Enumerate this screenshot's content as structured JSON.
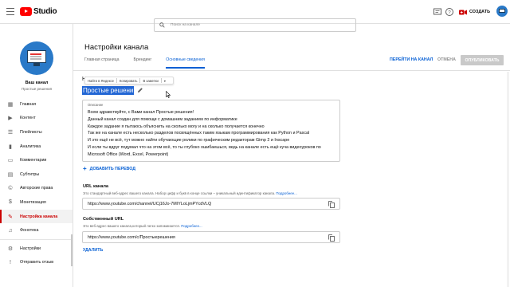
{
  "topbar": {
    "logo_text": "Studio",
    "search_placeholder": "Поиск на канале",
    "create_label": "СОЗДАТЬ"
  },
  "sidebar": {
    "channel_name": "Ваш канал",
    "channel_subtitle": "Простые решения",
    "items": [
      {
        "label": "Главная",
        "icon": "dashboard-icon"
      },
      {
        "label": "Контент",
        "icon": "content-icon"
      },
      {
        "label": "Плейлисты",
        "icon": "playlists-icon"
      },
      {
        "label": "Аналитика",
        "icon": "analytics-icon"
      },
      {
        "label": "Комментарии",
        "icon": "comments-icon"
      },
      {
        "label": "Субтитры",
        "icon": "subtitles-icon"
      },
      {
        "label": "Авторские права",
        "icon": "copyright-icon"
      },
      {
        "label": "Монетизация",
        "icon": "monetization-icon"
      },
      {
        "label": "Настройка канала",
        "icon": "customization-icon",
        "active": true
      },
      {
        "label": "Фонотека",
        "icon": "audio-library-icon"
      },
      {
        "label": "Настройки",
        "icon": "settings-icon"
      },
      {
        "label": "Отправить отзыв",
        "icon": "feedback-icon"
      }
    ]
  },
  "main": {
    "title": "Настройки канала",
    "tabs": [
      {
        "label": "Главная страница"
      },
      {
        "label": "Брендинг"
      },
      {
        "label": "Основные сведения",
        "active": true
      }
    ],
    "view_channel_label": "ПЕРЕЙТИ НА КАНАЛ",
    "cancel_label": "ОТМЕНА",
    "publish_label": "ОПУБЛИКОВАТЬ",
    "translate_bar": {
      "find": "Найти в Яндексе",
      "copy": "Копировать",
      "notes": "В заметки"
    },
    "name_prefix": "Н",
    "name_value": "Простые решени",
    "description": {
      "label": "Описание",
      "text": "Всем здравствуйте, с Вами канал Простые решения!\nДанный канал создан для помощи с домашним заданием по информатике\nКаждое задание я пытаюсь объяснить на сколько могу и на сколько получается конечно\nТак же на канале есть несколько разделов посвящённых таким языкам программирования как Python и Pascal\nИ это ещё не всё, тут можно найти обучающие ролики по графическим редакторам Gimp 2 и Inscape\nИ если ты вдруг подумал что на этом всё, то ты глубоко ошибаешься, ведь на канале есть ещё куча видеоуроков по\nMicrosoft Office (Word, Excel, Powerpoint)"
    },
    "add_language_label": "ДОБАВИТЬ ПЕРЕВОД",
    "channel_url": {
      "title": "URL канала",
      "desc": "Это стандартный веб-адрес вашего канала. Набор цифр и букв в конце ссылки – уникальный идентификатор канала.",
      "more": "Подробнее...",
      "value": "https://www.youtube.com/channel/UCj16Jo-7MIYLoLjmPYcdVLQ"
    },
    "custom_url": {
      "title": "Собственный URL",
      "desc": "Это веб-адрес вашего канала,который легко запоминается.",
      "more": "Подробнее...",
      "value": "https://www.youtube.com/c/Простыерешения"
    },
    "delete_label": "УДАЛИТЬ"
  },
  "colors": {
    "accent_blue": "#065fd4",
    "brand_red": "#ff0000",
    "active_red": "#cc0000"
  }
}
